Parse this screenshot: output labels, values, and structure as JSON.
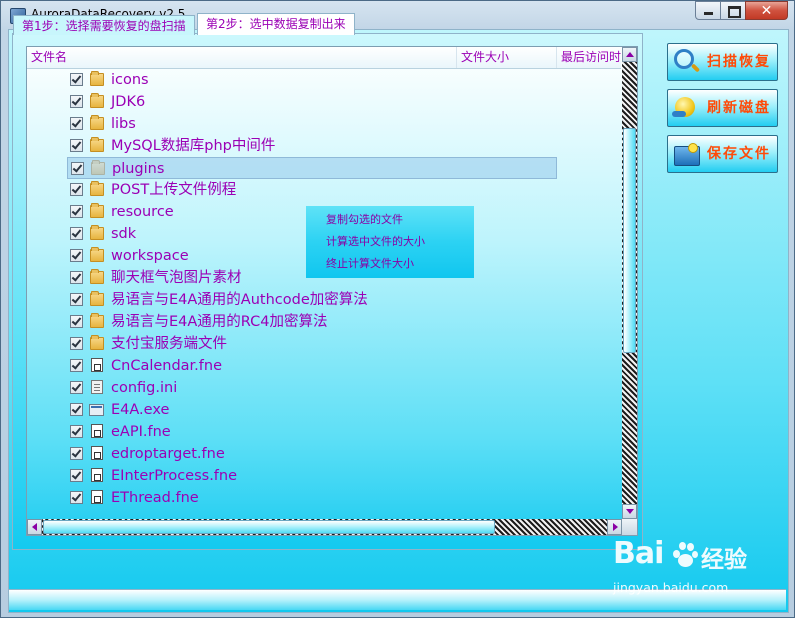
{
  "window": {
    "title": "AuroraDataRecovery v2.5",
    "minimize_symbol": "",
    "maximize_symbol": "",
    "close_symbol": "✕"
  },
  "tabs": [
    {
      "label": "第1步：选择需要恢复的盘扫描",
      "active": false
    },
    {
      "label": "第2步：选中数据复制出来",
      "active": true
    }
  ],
  "table": {
    "columns": {
      "name": "文件名",
      "size": "文件大小",
      "last_access": "最后访问时间"
    },
    "rows": [
      {
        "name": "icons",
        "type": "folder",
        "checked": true
      },
      {
        "name": "JDK6",
        "type": "folder",
        "checked": true
      },
      {
        "name": "libs",
        "type": "folder",
        "checked": true
      },
      {
        "name": "MySQL数据库php中间件",
        "type": "folder",
        "checked": true
      },
      {
        "name": "plugins",
        "type": "folder",
        "checked": true,
        "selected": true
      },
      {
        "name": "POST上传文件例程",
        "type": "folder",
        "checked": true
      },
      {
        "name": "resource",
        "type": "folder",
        "checked": true
      },
      {
        "name": "sdk",
        "type": "folder",
        "checked": true
      },
      {
        "name": "workspace",
        "type": "folder",
        "checked": true
      },
      {
        "name": "聊天框气泡图片素材",
        "type": "folder",
        "checked": true
      },
      {
        "name": "易语言与E4A通用的Authcode加密算法",
        "type": "folder",
        "checked": true
      },
      {
        "name": "易语言与E4A通用的RC4加密算法",
        "type": "folder",
        "checked": true
      },
      {
        "name": "支付宝服务端文件",
        "type": "folder",
        "checked": true
      },
      {
        "name": "CnCalendar.fne",
        "type": "fne",
        "checked": true
      },
      {
        "name": "config.ini",
        "type": "ini",
        "checked": true
      },
      {
        "name": "E4A.exe",
        "type": "exe",
        "checked": true
      },
      {
        "name": "eAPI.fne",
        "type": "fne",
        "checked": true
      },
      {
        "name": "edroptarget.fne",
        "type": "fne",
        "checked": true
      },
      {
        "name": "EInterProcess.fne",
        "type": "fne",
        "checked": true
      },
      {
        "name": "EThread.fne",
        "type": "fne",
        "checked": true
      }
    ]
  },
  "context_menu": {
    "items": [
      "复制勾选的文件",
      "计算选中文件的大小",
      "终止计算文件大小"
    ]
  },
  "side_buttons": [
    {
      "label": "扫描恢复",
      "icon": "scan-magnifier-icon"
    },
    {
      "label": "刷新磁盘",
      "icon": "refresh-disk-icon"
    },
    {
      "label": "保存文件",
      "icon": "save-file-icon"
    }
  ],
  "watermark": {
    "brand_left": "Bai",
    "brand_right": "经验",
    "url": "jingyan.baidu.com"
  },
  "colors": {
    "text_accent": "#9b00b5",
    "button_text": "#ff4a08",
    "panel_cyan": "#22cdf1"
  }
}
